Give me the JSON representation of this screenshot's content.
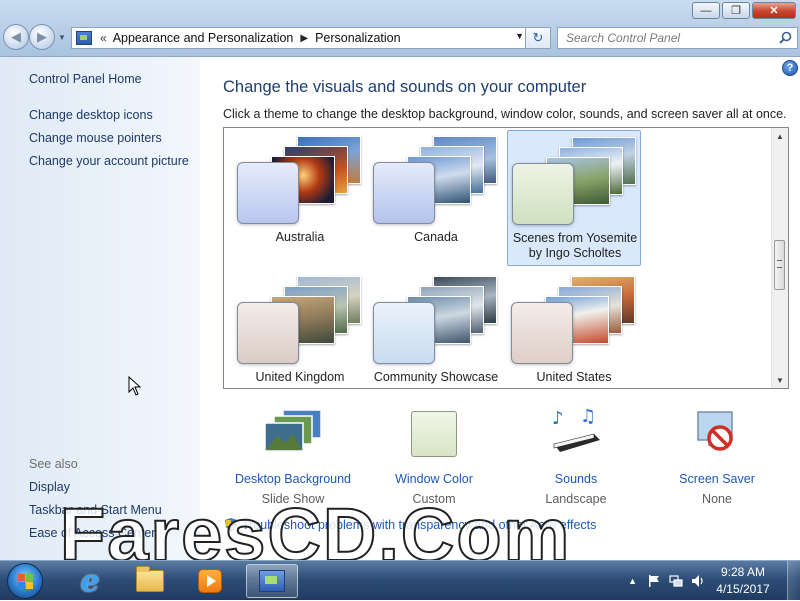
{
  "window": {
    "minimize_glyph": "—",
    "maximize_glyph": "❐",
    "close_glyph": "✕"
  },
  "navigation": {
    "back_glyph": "◀",
    "forward_glyph": "▶",
    "breadcrumb": [
      "Appearance and Personalization",
      "Personalization"
    ],
    "overflow_glyph": "«",
    "refresh_glyph": "↻",
    "search_placeholder": "Search Control Panel"
  },
  "sidebar": {
    "home": "Control Panel Home",
    "links": [
      "Change desktop icons",
      "Change mouse pointers",
      "Change your account picture"
    ],
    "see_also_header": "See also",
    "see_also": [
      "Display",
      "Taskbar and Start Menu",
      "Ease of Access Center"
    ]
  },
  "main": {
    "title": "Change the visuals and sounds on your computer",
    "subtitle": "Click a theme to change the desktop background, window color, sounds, and screen saver all at once.",
    "themes": [
      {
        "name": "Australia",
        "selected": false,
        "swatch_color": "#b9c6ef"
      },
      {
        "name": "Canada",
        "selected": false,
        "swatch_color": "#b3c3ec"
      },
      {
        "name": "Scenes from Yosemite by Ingo Scholtes",
        "selected": true,
        "swatch_color": "#cfe0bf"
      },
      {
        "name": "United Kingdom",
        "selected": false,
        "swatch_color": "#dcccc6"
      },
      {
        "name": "Community Showcase",
        "selected": false,
        "swatch_color": "#c9dcf1"
      },
      {
        "name": "United States",
        "selected": false,
        "swatch_color": "#dfcec8"
      }
    ],
    "settings": [
      {
        "link": "Desktop Background",
        "value": "Slide Show",
        "icon": "desktop-background-icon"
      },
      {
        "link": "Window Color",
        "value": "Custom",
        "icon": "window-color-icon"
      },
      {
        "link": "Sounds",
        "value": "Landscape",
        "icon": "sounds-icon"
      },
      {
        "link": "Screen Saver",
        "value": "None",
        "icon": "screen-saver-icon"
      }
    ],
    "troubleshoot": "Troubleshoot problems with transparency and other Aero effects"
  },
  "watermark": "FaresCD.Com",
  "taskbar": {
    "items": [
      "internet-explorer-icon",
      "windows-explorer-icon",
      "media-player-icon",
      "control-panel-icon"
    ],
    "time": "9:28 AM",
    "date": "4/15/2017",
    "tray_arrow": "▲"
  },
  "colors": {
    "link": "#1d58b4",
    "heading": "#1e3d6e",
    "selection": "#d9e8fb"
  }
}
